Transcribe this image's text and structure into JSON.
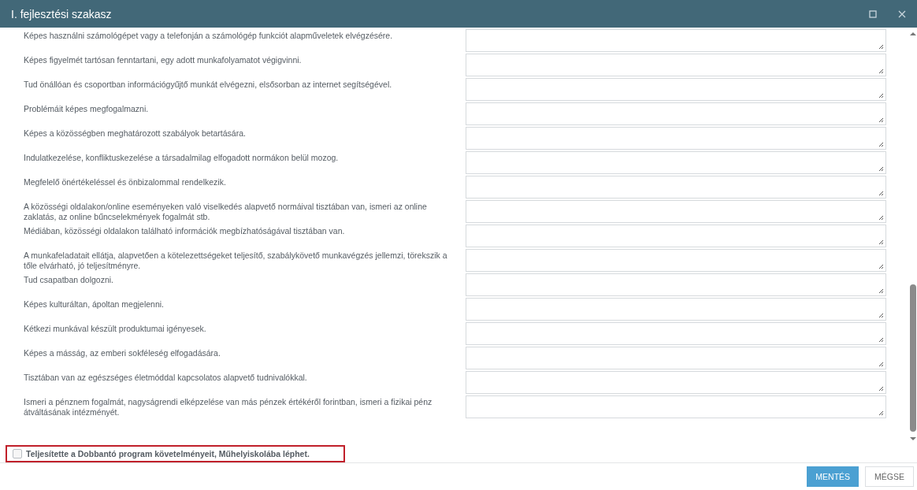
{
  "window": {
    "title": "I. fejlesztési szakasz"
  },
  "items": [
    {
      "text": "Képes használni számológépet vagy a telefonján a számológép funkciót alapműveletek elvégzésére."
    },
    {
      "text": "Képes figyelmét tartósan fenntartani, egy adott munkafolyamatot végigvinni."
    },
    {
      "text": "Tud önállóan és csoportban információgyűjtő munkát elvégezni, elsősorban az internet segítségével."
    },
    {
      "text": "Problémáit képes megfogalmazni."
    },
    {
      "text": "Képes a közösségben meghatározott szabályok betartására."
    },
    {
      "text": "Indulatkezelése, konfliktuskezelése a társadalmilag elfogadott normákon belül mozog."
    },
    {
      "text": "Megfelelő önértékeléssel és önbizalommal rendelkezik."
    },
    {
      "text": "A közösségi oldalakon/online eseményeken való viselkedés alapvető normáival tisztában van, ismeri az online zaklatás, az online bűncselekmények fogalmát stb."
    },
    {
      "text": "Médiában, közösségi oldalakon található információk megbízhatóságával tisztában van."
    },
    {
      "text": "A munkafeladatait ellátja, alapvetően a kötelezettségeket teljesítő, szabálykövető munkavégzés jellemzi, törekszik a tőle elvárható, jó teljesítményre."
    },
    {
      "text": "Tud csapatban dolgozni."
    },
    {
      "text": "Képes kulturáltan, ápoltan megjelenni."
    },
    {
      "text": "Kétkezi munkával készült produktumai igényesek."
    },
    {
      "text": "Képes a másság, az emberi sokféleség elfogadására."
    },
    {
      "text": "Tisztában van az egészséges életmóddal kapcsolatos alapvető tudnivalókkal."
    },
    {
      "text": "Ismeri a pénznem fogalmát, nagyságrendi elképzelése van más pénzek értékéről forintban, ismeri a fizikai pénz átváltásának intézményét."
    }
  ],
  "completion": {
    "label": "Teljesítette a Dobbantó program követelményeit, Műhelyiskolába léphet.",
    "checked": false
  },
  "buttons": [
    {
      "label": "MENTÉS",
      "kind": "primary"
    },
    {
      "label": "MÉGSE",
      "kind": "secondary"
    }
  ]
}
